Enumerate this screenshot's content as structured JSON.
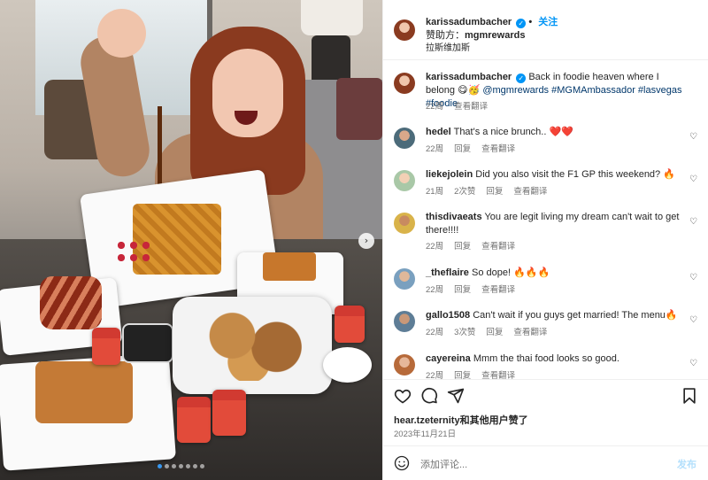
{
  "post": {
    "username": "karissadumbacher",
    "follow_label": "关注",
    "sponsor_prefix": "赞助方：",
    "sponsor_name": "mgmrewards",
    "location": "拉斯维加斯",
    "carousel": {
      "slides": 7,
      "active_index": 0
    }
  },
  "caption": {
    "username": "karissadumbacher",
    "text": "Back in foodie heaven where I belong 😋🥳",
    "tags": "@mgmrewards #MGMAmbassador #lasvegas #foodie",
    "time": "22周",
    "translate": "查看翻译"
  },
  "comments": [
    {
      "user": "hedel",
      "text": "That's a nice brunch.. ❤️❤️",
      "time": "22周",
      "reply": "回复",
      "translate": "查看翻译"
    },
    {
      "user": "liekejolein",
      "text": "Did you also visit the F1 GP this weekend? 🔥",
      "time": "21周",
      "likes": "2次赞",
      "reply": "回复",
      "translate": "查看翻译"
    },
    {
      "user": "thisdivaeats",
      "text": "You are legit living my dream can't wait to get there!!!!",
      "time": "22周",
      "reply": "回复",
      "translate": "查看翻译"
    },
    {
      "user": "_theflaire",
      "text": "So dope! 🔥🔥🔥",
      "time": "22周",
      "reply": "回复",
      "translate": "查看翻译"
    },
    {
      "user": "gallo1508",
      "text": "Can't wait if you guys get married! The menu🔥",
      "time": "22周",
      "likes": "3次赞",
      "reply": "回复",
      "translate": "查看翻译"
    },
    {
      "user": "cayereina",
      "text": "Mmm the thai food looks so good.",
      "time": "22周",
      "reply": "回复",
      "translate": "查看翻译"
    }
  ],
  "likes_line": {
    "user": "hear.tzeternity",
    "rest": "和其他用户赞了"
  },
  "date": "2023年11月21日",
  "comment_box": {
    "placeholder": "添加评论...",
    "post_label": "发布"
  },
  "colors": {
    "accent": "#0095f6",
    "muted": "#737373",
    "post_disabled": "#b2dffc"
  },
  "icons": [
    "heart-icon",
    "comment-icon",
    "share-icon",
    "bookmark-icon",
    "emoji-icon",
    "verified-icon",
    "chevron-right-icon"
  ]
}
